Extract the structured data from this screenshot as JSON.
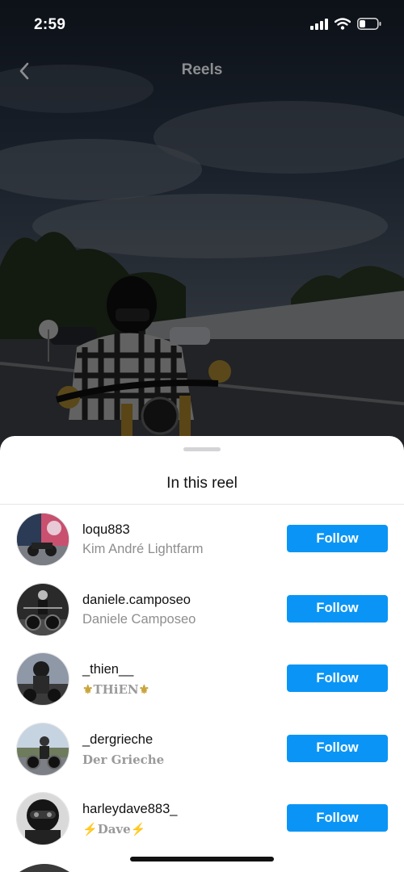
{
  "status_bar": {
    "time": "2:59"
  },
  "nav": {
    "title": "Reels"
  },
  "sheet": {
    "title": "In this reel",
    "users": [
      {
        "username": "loqu883",
        "fullname": "Kim André Lightfarm",
        "follow_label": "Follow"
      },
      {
        "username": "daniele.camposeo",
        "fullname": "Daniele Camposeo",
        "follow_label": "Follow"
      },
      {
        "username": "_thien__",
        "fullname": "THiEN",
        "follow_label": "Follow"
      },
      {
        "username": "_dergrieche",
        "fullname": "Der Grieche",
        "follow_label": "Follow"
      },
      {
        "username": "harleydave883_",
        "fullname": "Dave",
        "follow_label": "Follow"
      }
    ]
  },
  "colors": {
    "accent": "#0a95f6",
    "secondary_text": "#8e8e8e"
  }
}
